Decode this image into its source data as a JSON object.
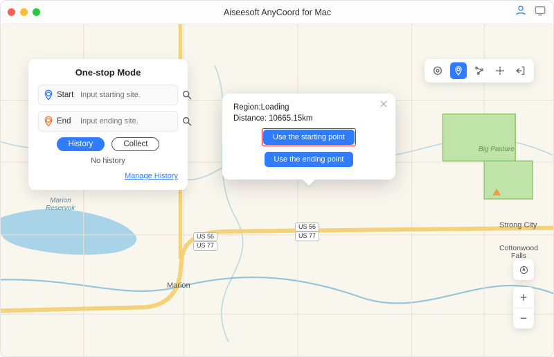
{
  "window": {
    "title": "Aiseesoft AnyCoord for Mac"
  },
  "panel": {
    "heading": "One-stop Mode",
    "start_label": "Start",
    "start_placeholder": "Input starting site.",
    "end_label": "End",
    "end_placeholder": "Input ending site.",
    "history_btn": "History",
    "collect_btn": "Collect",
    "no_history": "No history",
    "manage_link": "Manage History"
  },
  "popover": {
    "region_label": "Region:Loading",
    "distance_label": "Distance: 10665.15km",
    "use_start_btn": "Use the starting point",
    "use_end_btn": "Use the ending point"
  },
  "zoom": {
    "plus": "+",
    "minus": "−"
  },
  "map": {
    "shields": [
      "US 56",
      "US 77",
      "US 56",
      "US 77"
    ],
    "towns": {
      "marion": "Marion",
      "strong_city": "Strong City",
      "cottonwood": "Cottonwood\nFalls",
      "big_pasture": "Big Pasture",
      "marion_res": "Marion\nReservoir"
    }
  }
}
